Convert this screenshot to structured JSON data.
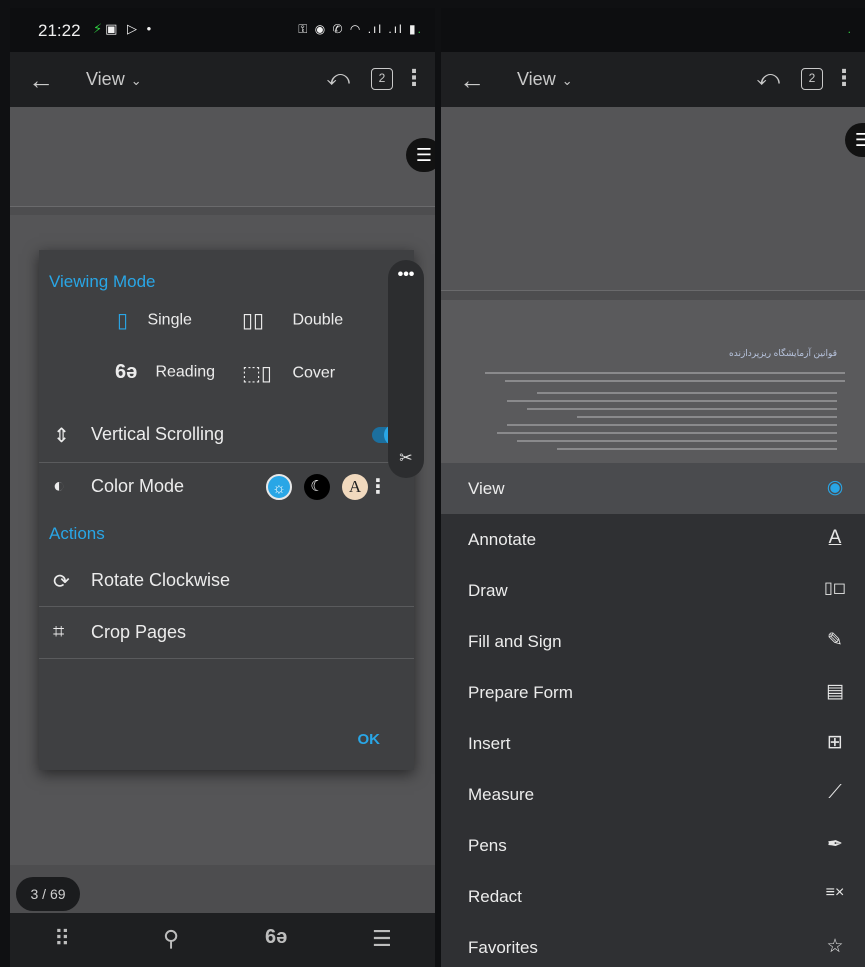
{
  "status_bar": {
    "time": "21:22"
  },
  "toolbar": {
    "view_label": "View",
    "page_count": "2"
  },
  "viewing_mode": {
    "title": "Viewing Mode",
    "options": [
      {
        "label": "Single",
        "icon": "single-page-icon"
      },
      {
        "label": "Double",
        "icon": "double-page-icon"
      },
      {
        "label": "Reading",
        "icon": "reading-glasses-icon"
      },
      {
        "label": "Cover",
        "icon": "cover-page-icon"
      }
    ]
  },
  "settings": {
    "vertical_scrolling": {
      "label": "Vertical Scrolling",
      "enabled": true
    },
    "color_mode": {
      "label": "Color Mode",
      "options": [
        "light",
        "dark",
        "sepia"
      ],
      "sepia_glyph": "A"
    }
  },
  "actions": {
    "title": "Actions",
    "items": [
      {
        "label": "Rotate Clockwise",
        "icon": "rotate-page-icon"
      },
      {
        "label": "Crop Pages",
        "icon": "crop-icon"
      }
    ]
  },
  "dialog": {
    "ok_label": "OK"
  },
  "page_indicator": "3 / 69",
  "document": {
    "heading": "قوانین آزمایشگاه ریزپردازنده"
  },
  "menu": {
    "items": [
      {
        "label": "View",
        "icon": "eye-icon",
        "active": true
      },
      {
        "label": "Annotate",
        "icon": "text-annotate-icon",
        "active": false
      },
      {
        "label": "Draw",
        "icon": "draw-shapes-icon",
        "active": false
      },
      {
        "label": "Fill and Sign",
        "icon": "fill-sign-icon",
        "active": false
      },
      {
        "label": "Prepare Form",
        "icon": "form-icon",
        "active": false
      },
      {
        "label": "Insert",
        "icon": "insert-image-icon",
        "active": false
      },
      {
        "label": "Measure",
        "icon": "ruler-icon",
        "active": false
      },
      {
        "label": "Pens",
        "icon": "pen-icon",
        "active": false
      },
      {
        "label": "Redact",
        "icon": "redact-icon",
        "active": false
      },
      {
        "label": "Favorites",
        "icon": "star-icon",
        "active": false
      }
    ]
  },
  "colors": {
    "accent": "#29a6e6",
    "dialog_bg": "#3f4042",
    "menu_bg": "#2f3033",
    "toolbar_bg": "#1e1f21"
  }
}
